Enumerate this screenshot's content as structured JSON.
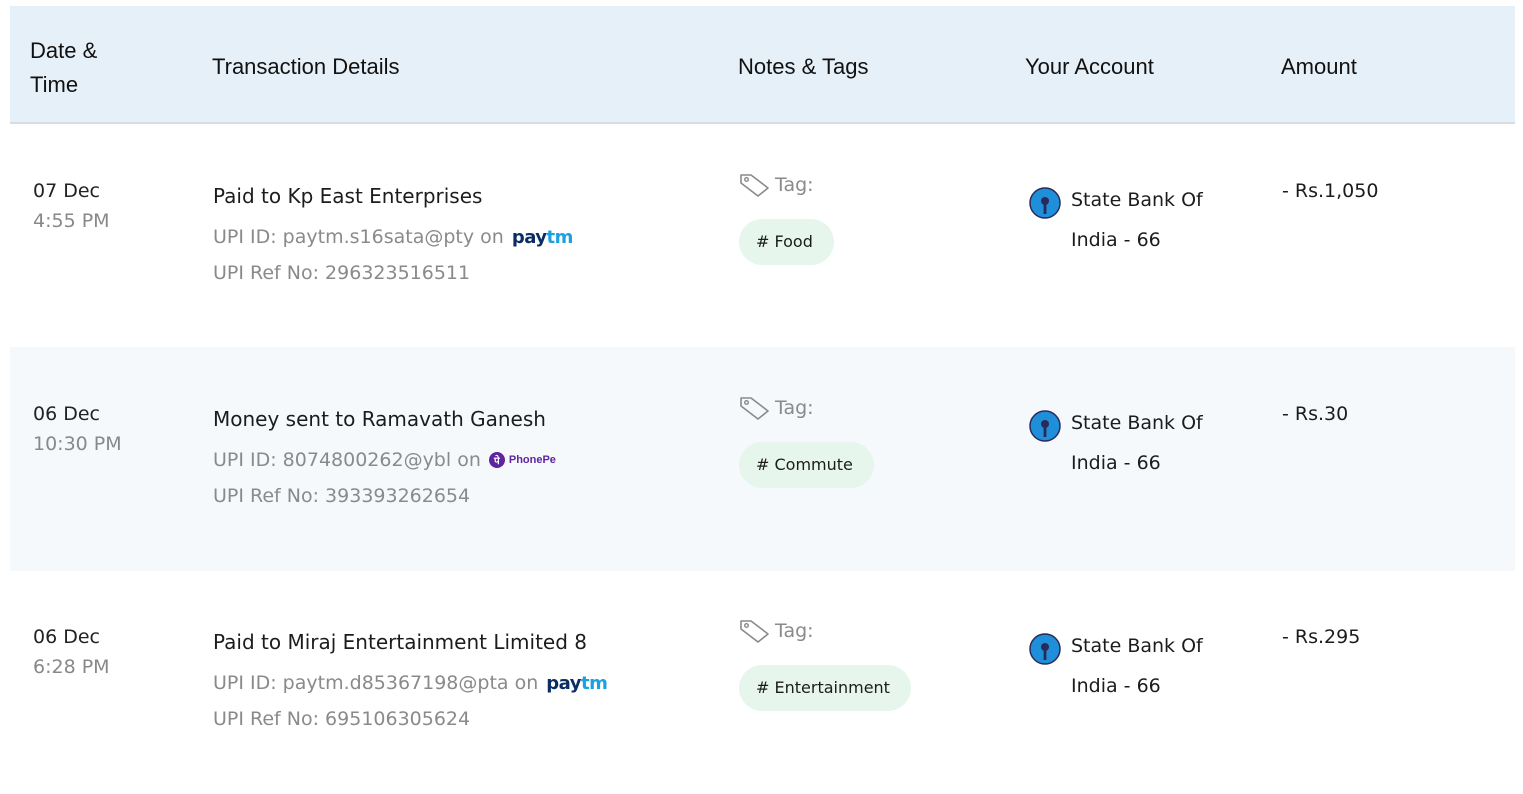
{
  "header": {
    "date_time": "Date & Time",
    "transaction_details": "Transaction Details",
    "notes_tags": "Notes & Tags",
    "your_account": "Your Account",
    "amount": "Amount"
  },
  "icons": {
    "tag": "tag-icon",
    "bank": "sbi-bank-icon",
    "paytm": "paytm-logo",
    "phonepe": "phonepe-logo"
  },
  "logos": {
    "paytm_pay": "pay",
    "paytm_tm": "tm",
    "phonepe_text": "PhonePe",
    "phonepe_glyph": "पे"
  },
  "colors": {
    "header_bg": "#e6f0f8",
    "tag_pill_bg": "#e6f6ec",
    "sbi_blue": "#1f8fd9",
    "paytm_navy": "#0b2d64",
    "paytm_blue": "#1ba0e2",
    "phonepe_purple": "#5f259f"
  },
  "transactions": [
    {
      "date": "07 Dec",
      "time": "4:55 PM",
      "title": "Paid to Kp East Enterprises",
      "upi_id_line": "UPI ID: paytm.s16sata@pty on",
      "upi_app": "paytm",
      "upi_ref_line": "UPI Ref No: 296323516511",
      "tag_label": "Tag:",
      "tag": "# Food",
      "account": "State Bank Of India - 66",
      "amount": "- Rs.1,050"
    },
    {
      "date": "06 Dec",
      "time": "10:30 PM",
      "title": "Money sent to Ramavath Ganesh",
      "upi_id_line": "UPI ID: 8074800262@ybl on",
      "upi_app": "phonepe",
      "upi_ref_line": "UPI Ref No: 393393262654",
      "tag_label": "Tag:",
      "tag": "# Commute",
      "account": "State Bank Of India - 66",
      "amount": "- Rs.30"
    },
    {
      "date": "06 Dec",
      "time": "6:28 PM",
      "title": "Paid to Miraj Entertainment Limited 8",
      "upi_id_line": "UPI ID: paytm.d85367198@pta on",
      "upi_app": "paytm",
      "upi_ref_line": "UPI Ref No: 695106305624",
      "tag_label": "Tag:",
      "tag": "# Entertainment",
      "account": "State Bank Of India - 66",
      "amount": "- Rs.295"
    }
  ]
}
